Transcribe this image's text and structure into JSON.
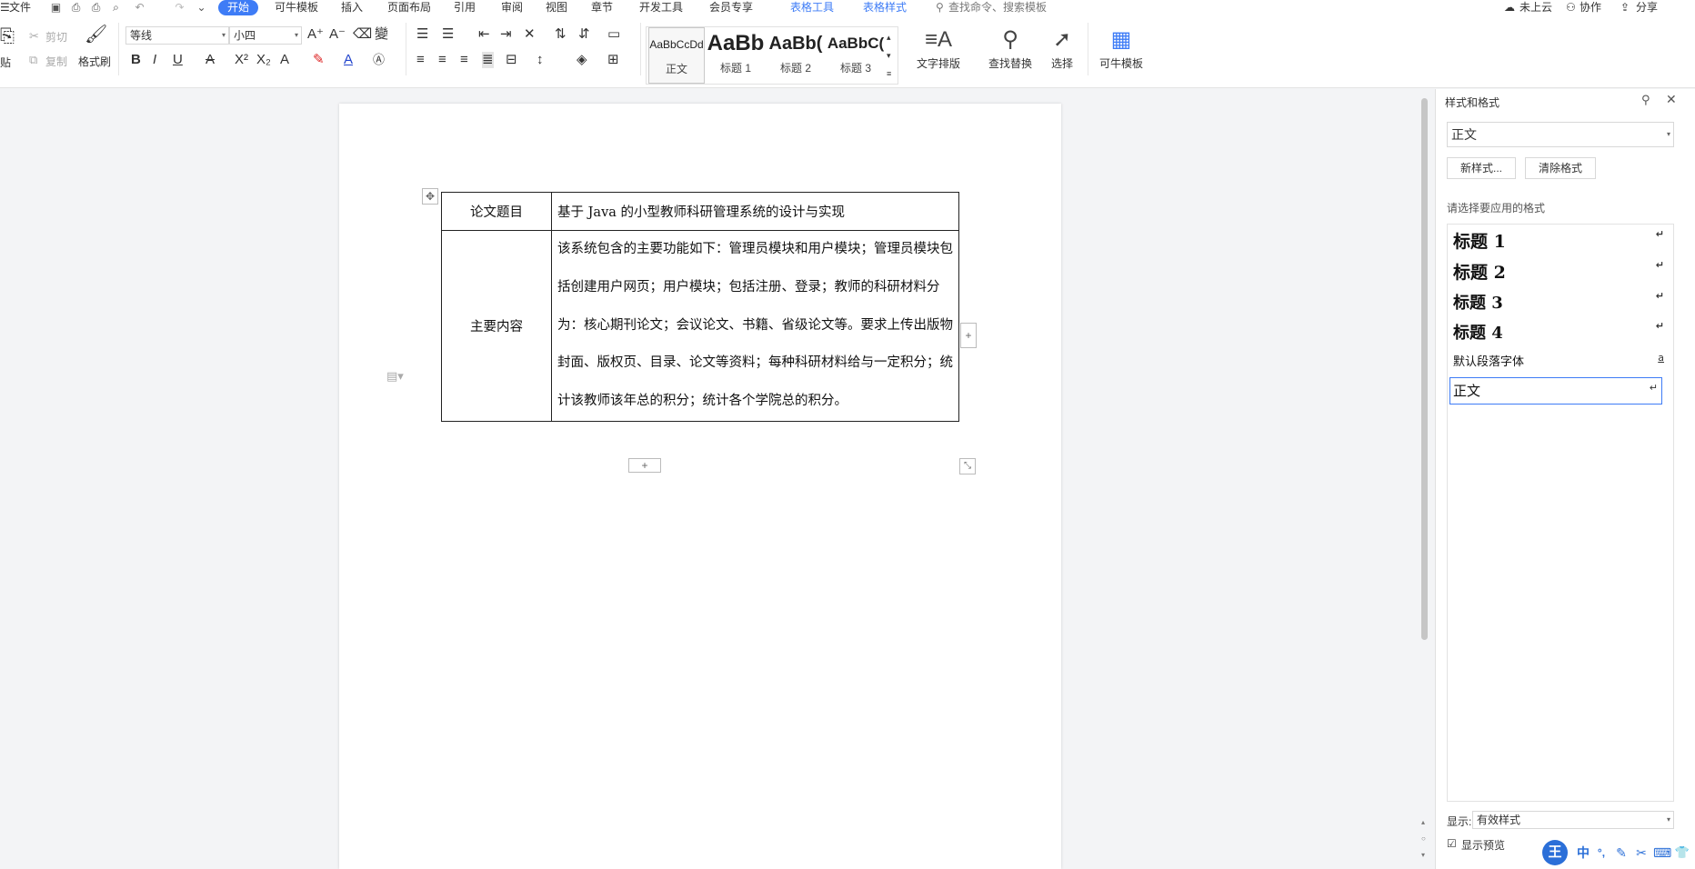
{
  "menubar": {
    "file_label": "文件",
    "tabs": [
      {
        "label": "开始",
        "active": true
      },
      {
        "label": "可牛模板"
      },
      {
        "label": "插入"
      },
      {
        "label": "页面布局"
      },
      {
        "label": "引用"
      },
      {
        "label": "审阅"
      },
      {
        "label": "视图"
      },
      {
        "label": "章节"
      },
      {
        "label": "开发工具"
      },
      {
        "label": "会员专享"
      },
      {
        "label": "表格工具"
      },
      {
        "label": "表格样式"
      }
    ],
    "search_placeholder": "查找命令、搜索模板",
    "cloud_label": "未上云",
    "collab_label": "协作",
    "share_label": "分享"
  },
  "ribbon": {
    "paste_label": "贴",
    "cut_label": "剪切",
    "copy_label": "复制",
    "format_painter_label": "格式刷",
    "font_name": "等线",
    "font_size": "小四",
    "styles": [
      {
        "preview": "AaBbCcDd",
        "name": "正文"
      },
      {
        "preview": "AaBb",
        "name": "标题 1"
      },
      {
        "preview": "AaBb(",
        "name": "标题 2"
      },
      {
        "preview": "AaBbC(",
        "name": "标题 3"
      }
    ],
    "text_layout_label": "文字排版",
    "find_replace_label": "查找替换",
    "select_label": "选择",
    "template_label": "可牛模板"
  },
  "document": {
    "table": {
      "row1_label": "论文题目",
      "row1_value": "基于 Java 的小型教师科研管理系统的设计与实现",
      "row2_label": "主要内容",
      "row2_value": "该系统包含的主要功能如下：管理员模块和用户模块；管理员模块包括创建用户网页；用户模块；包括注册、登录；教师的科研材料分为：核心期刊论文；会议论文、书籍、省级论文等。要求上传出版物封面、版权页、目录、论文等资料；每种科研材料给与一定积分；统计该教师该年总的积分；统计各个学院总的积分。"
    }
  },
  "panel": {
    "title": "样式和格式",
    "current_style": "正文",
    "new_style_label": "新样式...",
    "clear_format_label": "清除格式",
    "apply_prompt": "请选择要应用的格式",
    "items": [
      {
        "label": "标题 1",
        "mark": "↵"
      },
      {
        "label": "标题 2",
        "mark": "↵"
      },
      {
        "label": "标题 3",
        "mark": "↵"
      },
      {
        "label": "标题 4",
        "mark": "↵"
      },
      {
        "label": "默认段落字体",
        "mark": "a"
      },
      {
        "label": "正文",
        "mark": "↵"
      }
    ],
    "show_label": "显示:",
    "show_value": "有效样式",
    "preview_label": "显示预览"
  },
  "ime": {
    "items": [
      "中",
      "°,",
      "✎",
      "✂",
      "⌨",
      "👕"
    ]
  }
}
